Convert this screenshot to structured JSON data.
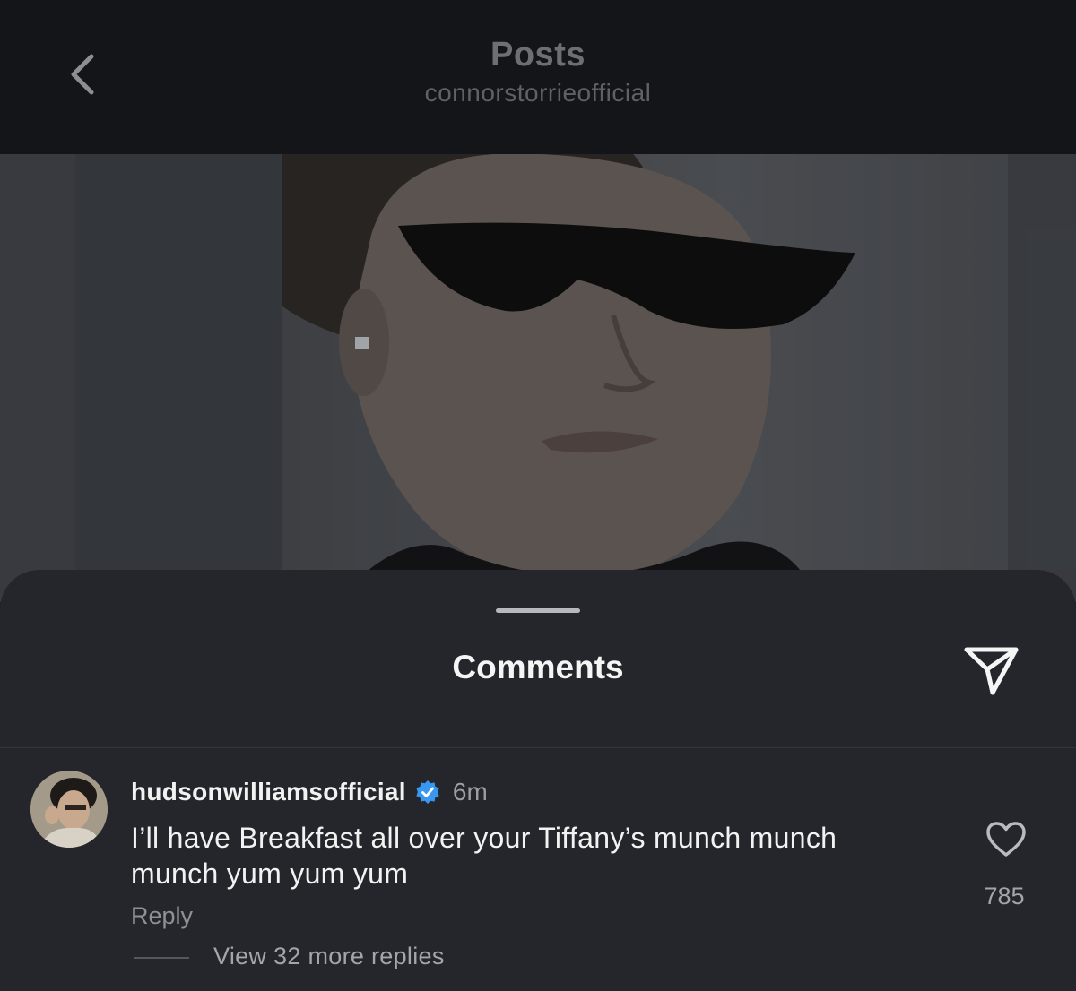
{
  "header": {
    "title": "Posts",
    "subtitle": "connorstorrieofficial"
  },
  "sheet": {
    "title": "Comments"
  },
  "comment": {
    "username": "hudsonwilliamsofficial",
    "verified": true,
    "time": "6m",
    "text": "I’ll have Breakfast all over your Tiffany’s munch munch munch yum yum yum",
    "reply_label": "Reply",
    "view_replies_label": "View 32 more replies",
    "like_count": "785"
  },
  "colors": {
    "background": "#1d1e22",
    "header": "#141518",
    "sheet": "#25262b",
    "verified_badge": "#3897f0"
  },
  "icons": {
    "back": "chevron-left-icon",
    "share": "paper-plane-icon",
    "verified": "verified-badge-icon",
    "like": "heart-icon"
  }
}
